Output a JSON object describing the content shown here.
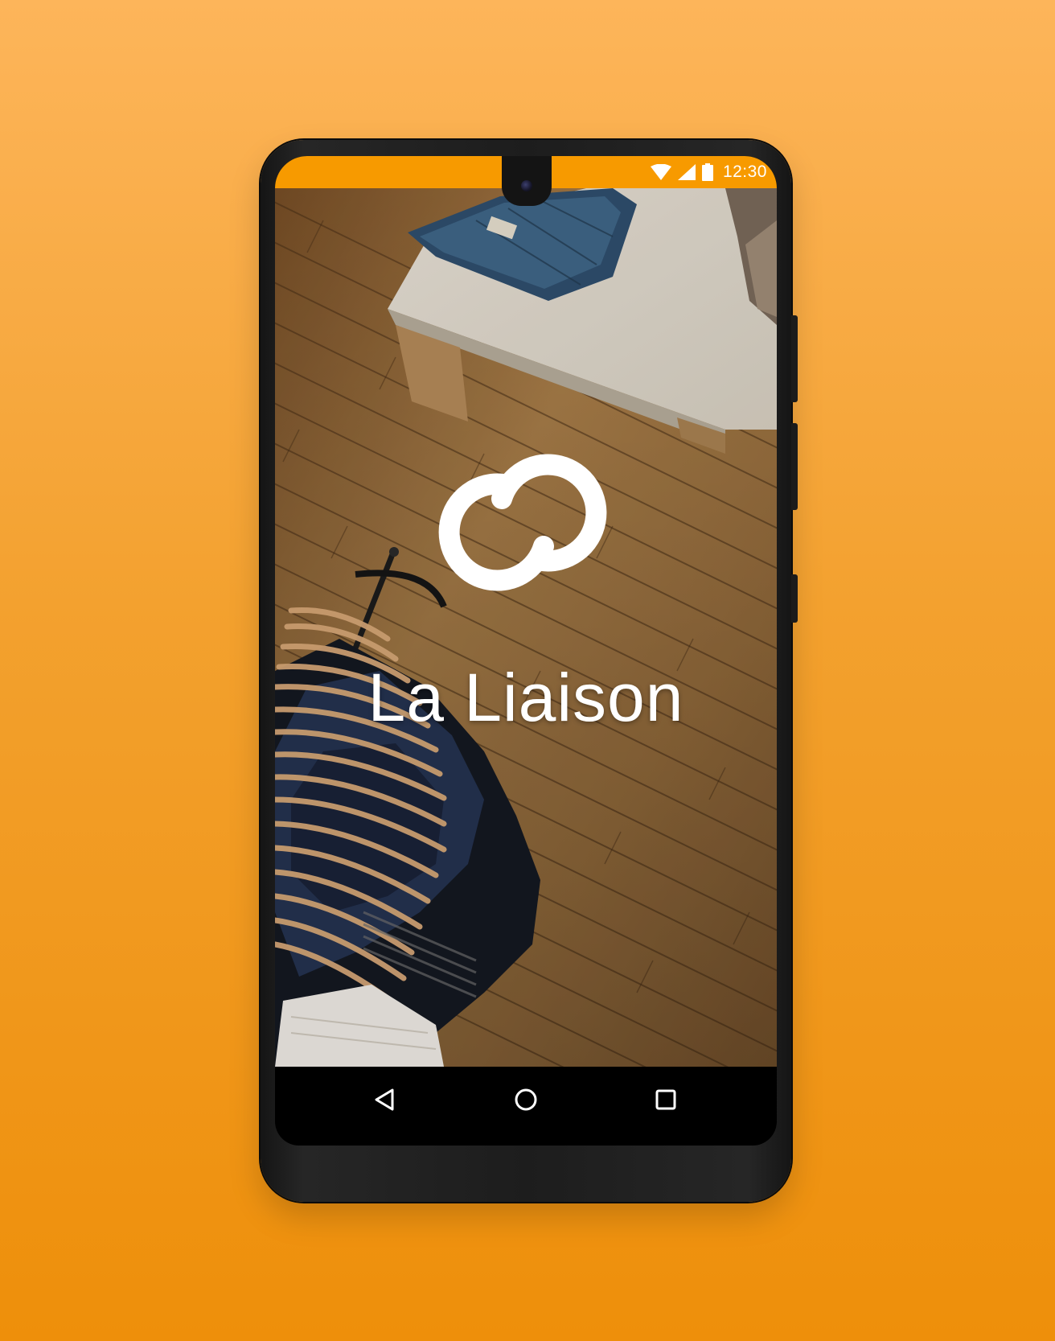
{
  "status_bar": {
    "time": "12:30",
    "icons": [
      "wifi-icon",
      "cellular-signal-icon",
      "battery-icon"
    ],
    "background_color": "#f79a00"
  },
  "splash": {
    "app_name": "La Liaison",
    "logo_icon": "interlinked-rings-logo",
    "background_image": "clothing store floor with wooden planks, a table of folded jeans and a rack of hangers"
  },
  "navigation_bar": {
    "buttons": [
      "back-icon",
      "home-icon",
      "recents-icon"
    ]
  },
  "colors": {
    "page_background_top": "#fdb55a",
    "page_background_bottom": "#ee8f0a",
    "phone_body": "#1d1d1d",
    "status_bar": "#f79a00",
    "text": "#ffffff"
  }
}
